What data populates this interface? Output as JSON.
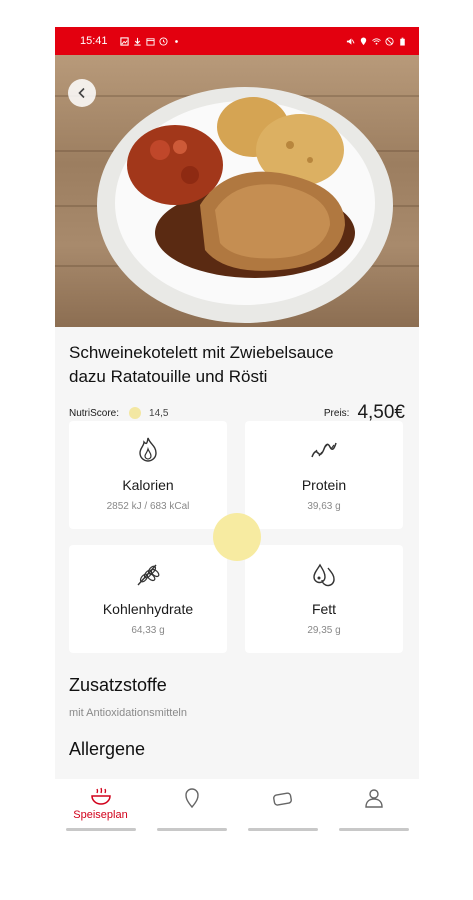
{
  "status_bar": {
    "time": "15:41"
  },
  "meal": {
    "title_line1": "Schweinekotelett mit Zwiebelsauce",
    "title_line2": "dazu Ratatouille und Rösti",
    "nutriscore_label": "NutriScore:",
    "nutriscore_value": "14,5",
    "price_label": "Preis:",
    "price_value": "4,50€"
  },
  "nutrients": [
    {
      "label": "Kalorien",
      "value": "2852 kJ / 683 kCal",
      "icon": "flame-icon"
    },
    {
      "label": "Protein",
      "value": "39,63 g",
      "icon": "protein-icon"
    },
    {
      "label": "Kohlenhydrate",
      "value": "64,33 g",
      "icon": "wheat-icon"
    },
    {
      "label": "Fett",
      "value": "29,35 g",
      "icon": "oil-drop-icon"
    }
  ],
  "sections": {
    "additives_title": "Zusatzstoffe",
    "additives_text": "mit Antioxidationsmitteln",
    "allergens_title": "Allergene"
  },
  "bottom_nav": {
    "items": [
      {
        "label": "Speiseplan",
        "icon": "bowl-icon",
        "active": true
      },
      {
        "label": "",
        "icon": "location-pin-icon",
        "active": false
      },
      {
        "label": "",
        "icon": "card-icon",
        "active": false
      },
      {
        "label": "",
        "icon": "user-icon",
        "active": false
      }
    ]
  },
  "colors": {
    "brand_red": "#e3000f",
    "nutri_yellow": "#f3e7a2",
    "nav_active": "#d1001a"
  }
}
